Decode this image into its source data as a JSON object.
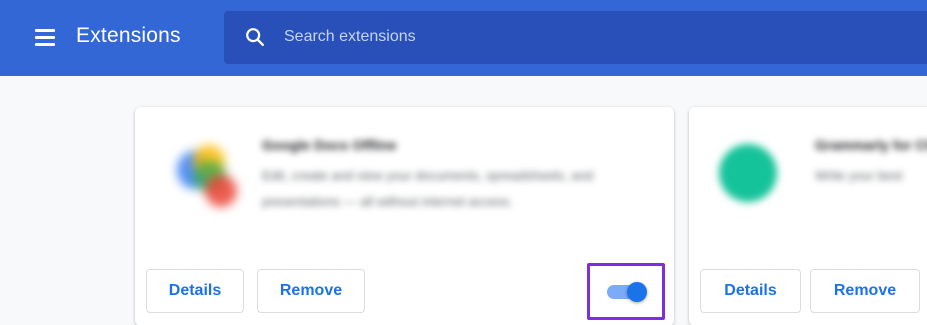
{
  "header": {
    "title": "Extensions",
    "menu_icon": "hamburger-menu-icon"
  },
  "search": {
    "placeholder": "Search extensions",
    "value": "",
    "icon": "search-icon"
  },
  "extensions": [
    {
      "name": "Google Docs Offline",
      "description": "Edit, create and view your documents, spreadsheets, and presentations — all without internet access.",
      "icon": "google-docs-offline-icon",
      "details_label": "Details",
      "remove_label": "Remove",
      "enabled": true,
      "highlighted": true
    },
    {
      "name": "Grammarly for Chrome",
      "description": "Write your best",
      "icon": "grammarly-icon",
      "details_label": "Details",
      "remove_label": "Remove"
    }
  ],
  "colors": {
    "header_bg": "#3367d6",
    "search_bg": "#2850b8",
    "accent": "#1a73e8",
    "highlight_border": "#7b2fdd",
    "toggle_track": "#7baaf7"
  }
}
